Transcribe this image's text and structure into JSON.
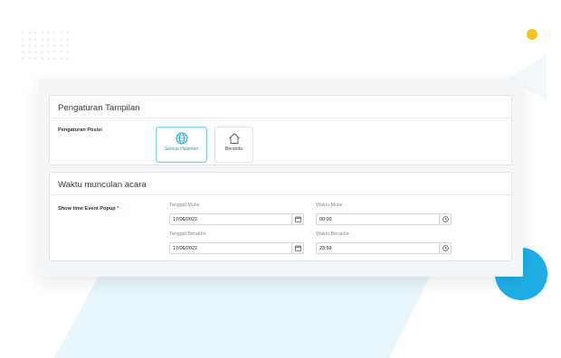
{
  "theme": {
    "accent": "#1eaee6",
    "highlight": "#f5c518",
    "selected_border": "#7fd0ea",
    "required": "#e53935"
  },
  "display_settings": {
    "title": "Pengaturan Tampilan",
    "position_label": "Pengaturan Posisi",
    "options": [
      {
        "label": "Semua Halaman",
        "icon": "globe-icon",
        "selected": true
      },
      {
        "label": "Beranda",
        "icon": "home-icon",
        "selected": false
      }
    ]
  },
  "event_time": {
    "title": "Waktu munculan acara",
    "field_label": "Show time Event Popup",
    "required_mark": "*",
    "start_date_label": "Tanggal Mulai",
    "start_date_value": "17/06/2022",
    "start_time_label": "Waktu Mulai",
    "start_time_value": "00:00",
    "end_date_label": "Tanggal Berakhir",
    "end_date_value": "17/06/2022",
    "end_time_label": "Waktu Berakhir",
    "end_time_value": "23:59",
    "date_icon": "calendar-icon",
    "time_icon": "clock-icon"
  }
}
